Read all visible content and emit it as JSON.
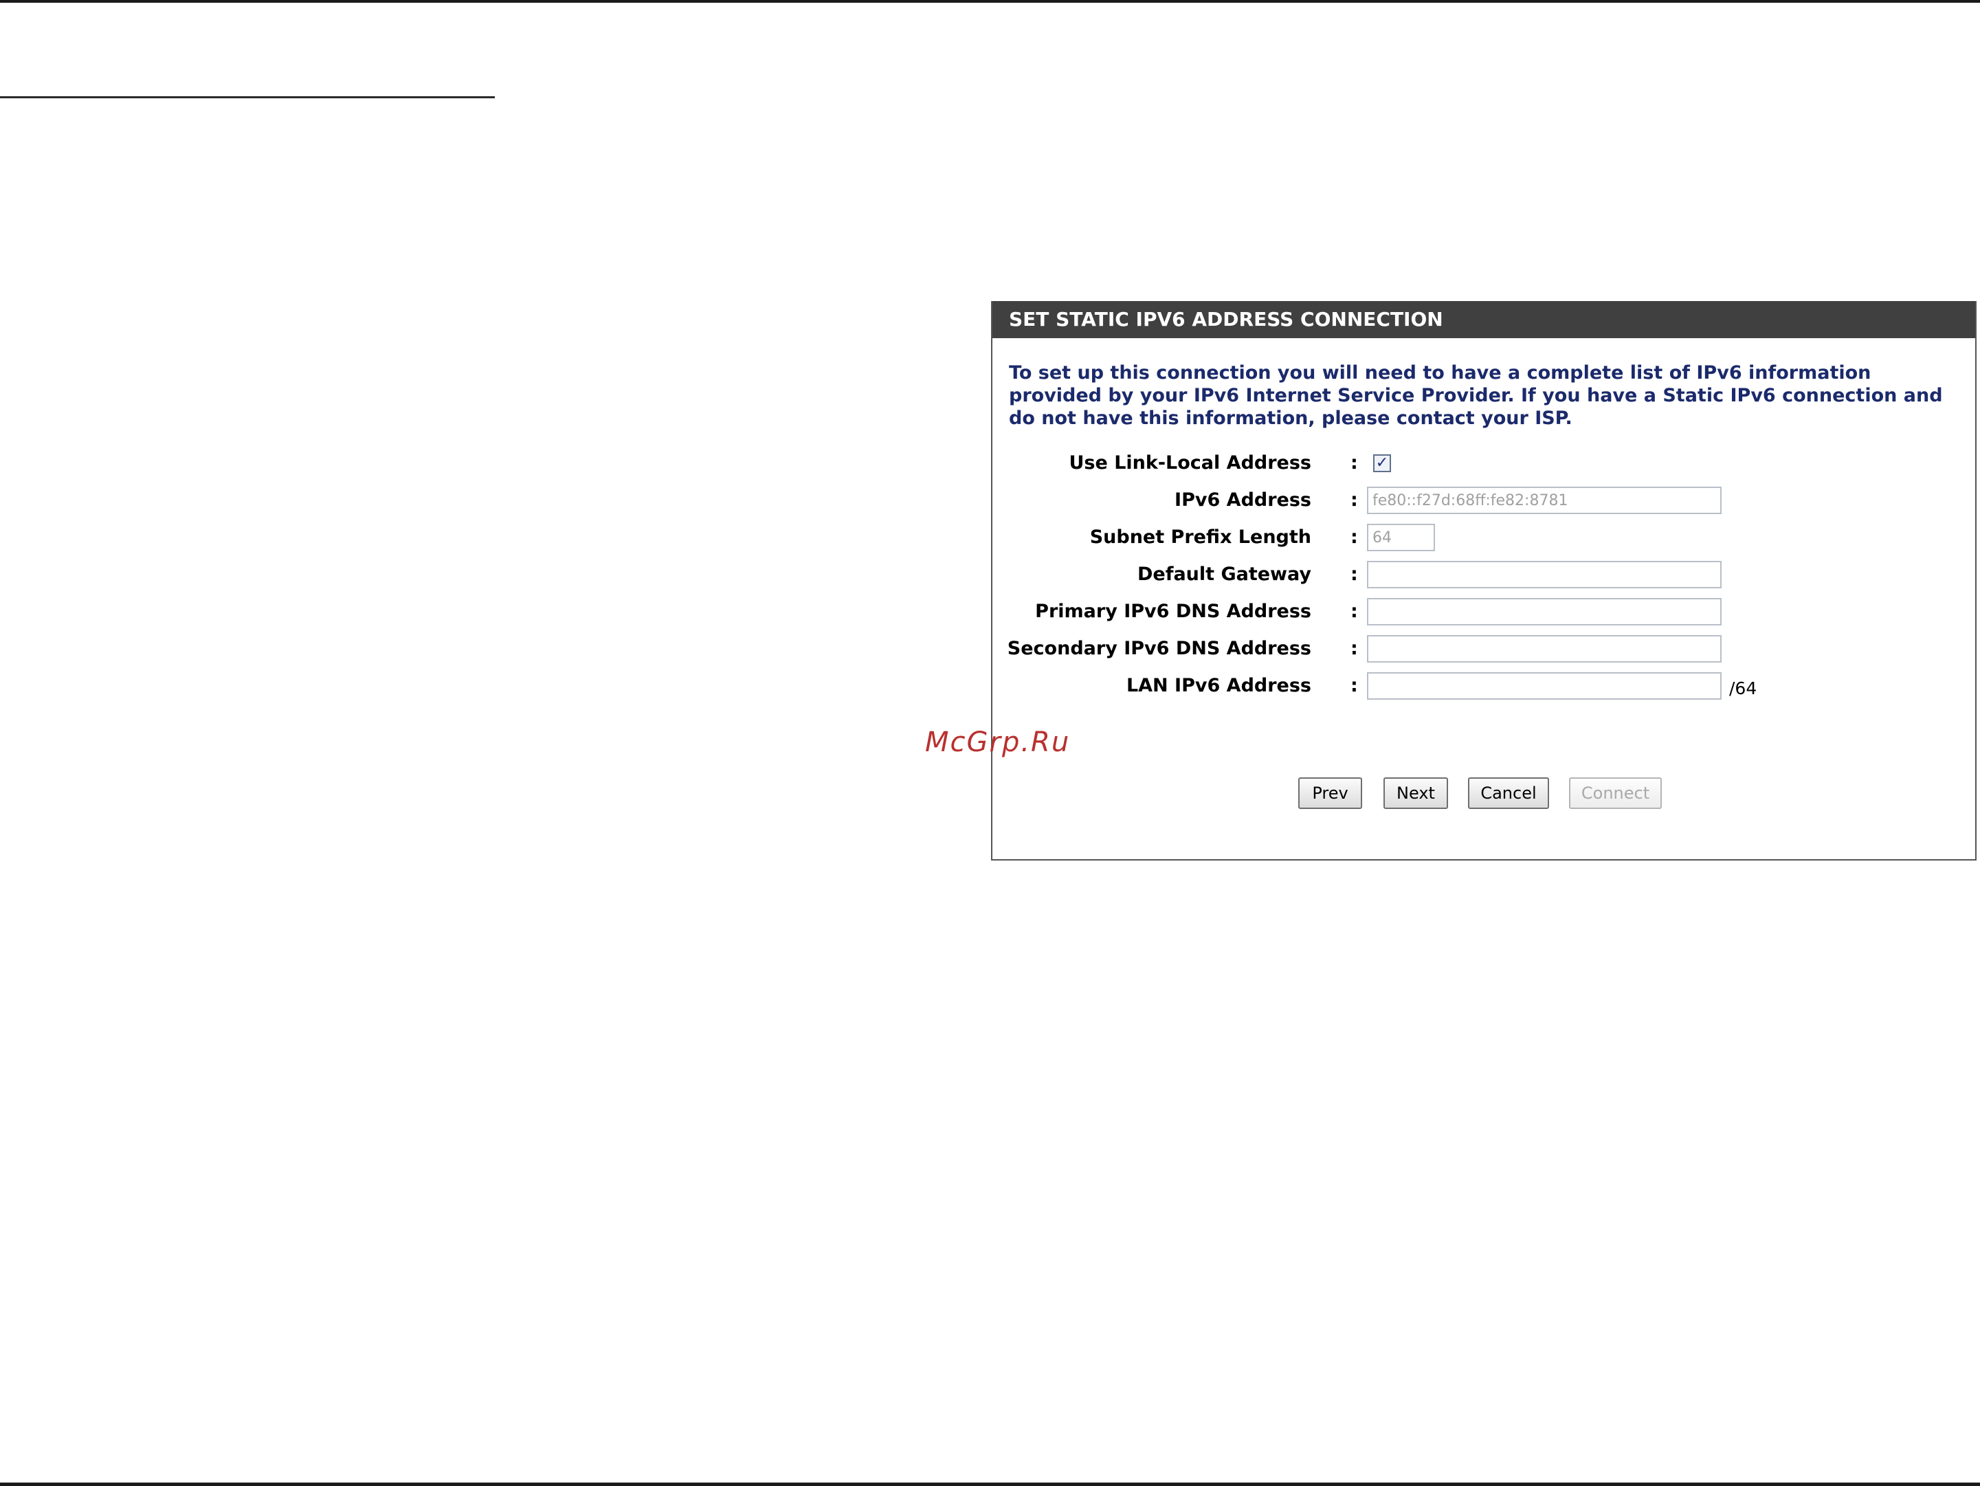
{
  "watermark": "McGrp.Ru",
  "panel": {
    "title": "SET STATIC IPV6 ADDRESS CONNECTION",
    "intro": "To set up this connection you will need to have a complete list of IPv6 information provided by your IPv6 Internet Service Provider. If you have a Static IPv6 connection and do not have this information, please contact your ISP."
  },
  "form": {
    "separator": ":",
    "use_link_local": {
      "label": "Use Link-Local Address",
      "checked": true,
      "check_glyph": "✓"
    },
    "ipv6_address": {
      "label": "IPv6 Address",
      "value": "fe80::f27d:68ff:fe82:8781"
    },
    "subnet_prefix_length": {
      "label": "Subnet Prefix Length",
      "value": "64"
    },
    "default_gateway": {
      "label": "Default Gateway",
      "value": ""
    },
    "primary_dns": {
      "label": "Primary IPv6 DNS Address",
      "value": ""
    },
    "secondary_dns": {
      "label": "Secondary IPv6 DNS Address",
      "value": ""
    },
    "lan_ipv6_address": {
      "label": "LAN IPv6 Address",
      "value": "",
      "suffix": "/64"
    }
  },
  "buttons": {
    "prev": "Prev",
    "next": "Next",
    "cancel": "Cancel",
    "connect": "Connect"
  }
}
